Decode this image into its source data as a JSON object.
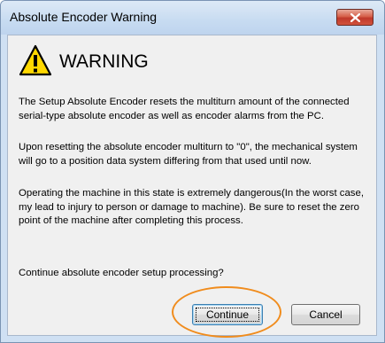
{
  "window": {
    "title": "Absolute Encoder Warning",
    "close_icon": "close-icon"
  },
  "warning": {
    "icon": "warning-triangle-icon",
    "heading": "WARNING"
  },
  "messages": {
    "p1": "The Setup Absolute Encoder resets the multiturn amount of the connected serial-type absolute encoder as well as encoder alarms from the PC.",
    "p2": "Upon resetting the absolute encoder multiturn to \"0\", the mechanical system will go to a position data system differing from that used until now.",
    "p3": "Operating the machine in this state is extremely dangerous(In the worst case, my lead to injury to person or damage to machine). Be sure to reset the zero point of the machine after completing this process.",
    "prompt": "Continue absolute encoder setup processing?"
  },
  "buttons": {
    "continue_label": "Continue",
    "cancel_label": "Cancel"
  },
  "colors": {
    "highlight": "#f08c1d",
    "close_button": "#c0392b",
    "warning_fill": "#ffd800"
  }
}
